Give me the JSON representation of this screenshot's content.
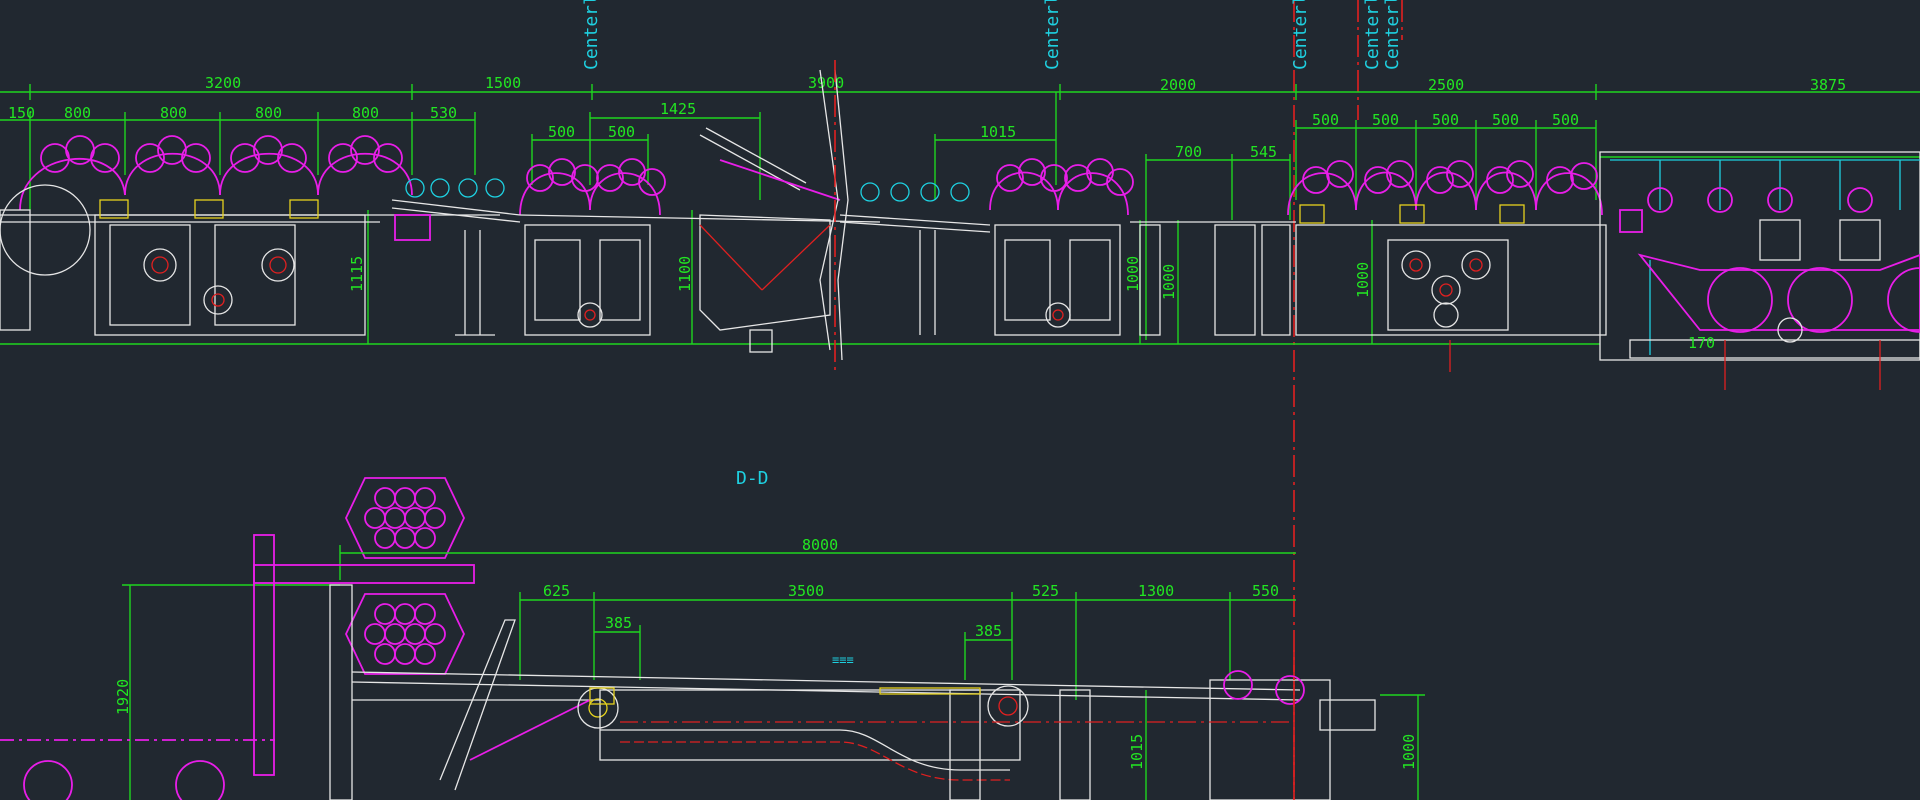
{
  "drawing": {
    "background": "#212830",
    "colors": {
      "dimension": "#1fd51f",
      "machine": "#e6e6e6",
      "rolls": "#e81ee8",
      "labels": "#1ed0e0",
      "centerline": "#e02020",
      "detail": "#e6d21e"
    },
    "centerline_labels": [
      "Centerli",
      "Centerli",
      "Centerli",
      "Centerli",
      "Centerli"
    ],
    "section_label": "D-D",
    "top_overall_dims": [
      "3200",
      "1500",
      "3900",
      "2000",
      "2500",
      "3875"
    ],
    "top_sub_dims_a": [
      "150",
      "800",
      "800",
      "800",
      "800",
      "530"
    ],
    "top_sub_dims_b": [
      "500",
      "500",
      "1425"
    ],
    "top_sub_dims_c": [
      "1015",
      "700",
      "545"
    ],
    "top_sub_dims_d": [
      "500",
      "500",
      "500",
      "500",
      "500"
    ],
    "top_vertical_dims": [
      "1115",
      "1100",
      "1000",
      "1000",
      "1000"
    ],
    "bottom_overall_dim": "8000",
    "bottom_dims": [
      "625",
      "3500",
      "525",
      "1300",
      "550"
    ],
    "bottom_sub_dims": [
      "385",
      "385"
    ],
    "bottom_vertical_dims": [
      "1920",
      "1015",
      "1000"
    ],
    "small_dim": "170"
  }
}
